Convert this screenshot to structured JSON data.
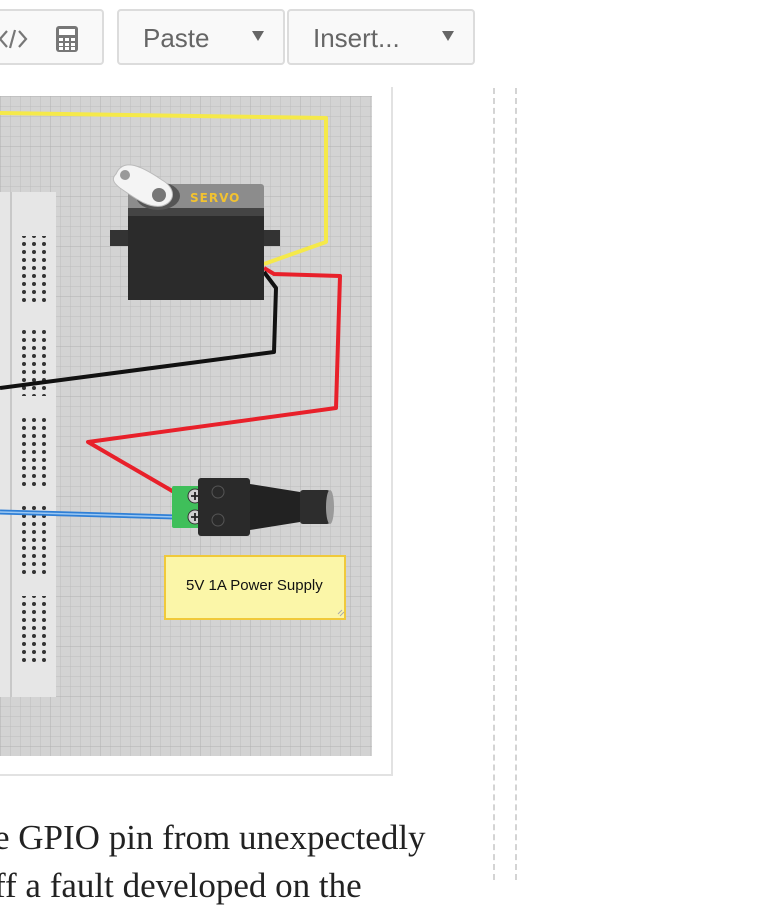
{
  "toolbar": {
    "code_icon": "code-icon",
    "calculator_icon": "calculator-icon",
    "paste": {
      "label": "Paste"
    },
    "insert": {
      "label": "Insert..."
    }
  },
  "diagram": {
    "servo_label": "SERVO",
    "note_text": "5V 1A Power Supply",
    "icons": [
      "servo-icon",
      "dc-barrel-jack-icon",
      "breadboard-icon",
      "sticky-note-icon"
    ],
    "wire_colors": {
      "signal": "#f5e94a",
      "power": "#e8202a",
      "ground": "#111111",
      "gpio": "#2f7fd6"
    },
    "note_color": "#fbf6a8"
  },
  "article": {
    "line1": "e GPIO pin from unexpectedly",
    "line2": "ff a fault developed on the"
  }
}
